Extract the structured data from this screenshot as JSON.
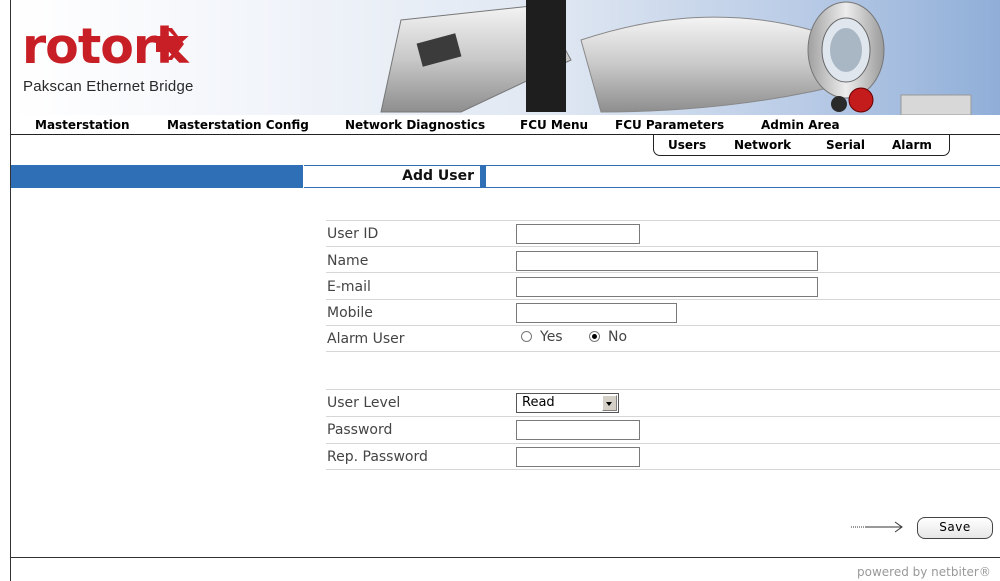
{
  "brand": {
    "logo_text": "rotork",
    "tagline": "Pakscan Ethernet Bridge"
  },
  "nav": {
    "items": [
      {
        "label": "Masterstation"
      },
      {
        "label": "Masterstation Config"
      },
      {
        "label": "Network Diagnostics"
      },
      {
        "label": "FCU Menu"
      },
      {
        "label": "FCU Parameters"
      },
      {
        "label": "Admin Area"
      }
    ],
    "sub_items": [
      {
        "label": "Users"
      },
      {
        "label": "Network"
      },
      {
        "label": "Serial"
      },
      {
        "label": "Alarm"
      }
    ]
  },
  "page": {
    "title": "Add User"
  },
  "form": {
    "user_id_label": "User ID",
    "name_label": "Name",
    "email_label": "E-mail",
    "mobile_label": "Mobile",
    "alarm_user_label": "Alarm User",
    "alarm_yes_label": "Yes",
    "alarm_no_label": "No",
    "alarm_selected": "No",
    "user_level_label": "User Level",
    "user_level_value": "Read",
    "password_label": "Password",
    "rep_password_label": "Rep. Password",
    "user_id_value": "",
    "name_value": "",
    "email_value": "",
    "mobile_value": "",
    "password_value": "",
    "rep_password_value": ""
  },
  "actions": {
    "save_label": "Save"
  },
  "footer": {
    "powered_by": "powered by netbiter®"
  },
  "colors": {
    "accent_blue": "#2f6fb5",
    "logo_red": "#c81f26"
  }
}
